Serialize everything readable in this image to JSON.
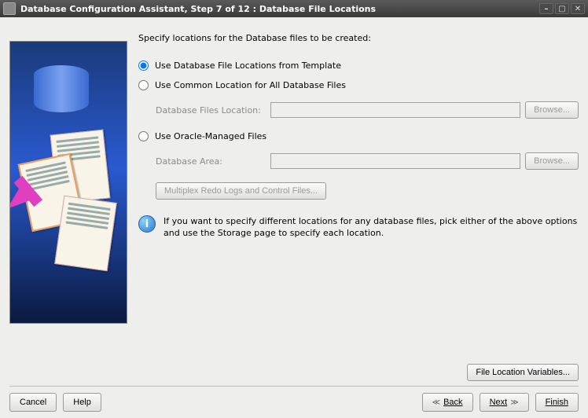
{
  "title": "Database Configuration Assistant, Step 7 of 12 : Database File Locations",
  "instruction": "Specify locations for the Database files to be created:",
  "options": {
    "template": "Use Database File Locations from Template",
    "common": "Use Common Location for All Database Files",
    "common_label": "Database Files Location:",
    "common_value": "",
    "omf": "Use Oracle-Managed Files",
    "omf_label": "Database Area:",
    "omf_value": "",
    "browse": "Browse...",
    "multiplex": "Multiplex Redo Logs and Control Files..."
  },
  "info": "If you want to specify different locations for any database files, pick either of the above options and use the Storage page to specify each location.",
  "file_loc_vars": "File Location Variables...",
  "footer": {
    "cancel": "Cancel",
    "help": "Help",
    "back": "Back",
    "next": "Next",
    "finish": "Finish"
  }
}
